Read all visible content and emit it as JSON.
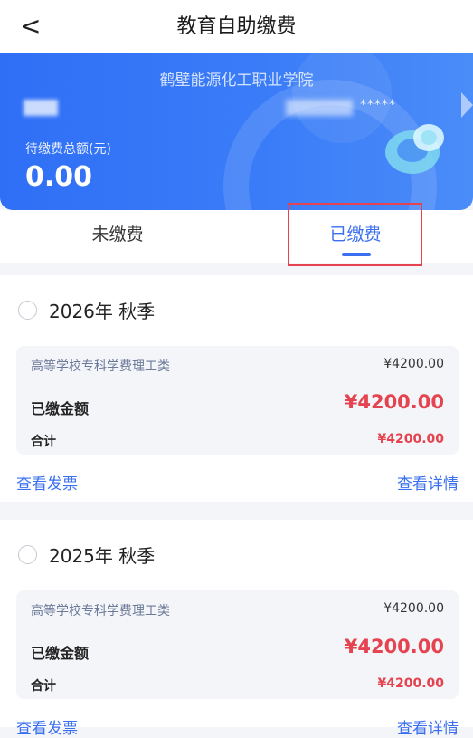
{
  "header": {
    "back_icon": "chevron-left-icon",
    "back_glyph": "<",
    "title": "教育自助缴费"
  },
  "banner": {
    "school": "鹤壁能源化工职业学院",
    "masked_id": "*****",
    "total_label": "待缴费总额(元)",
    "total_amount": "0.00",
    "accent": "#3a7cf8"
  },
  "tabs": [
    {
      "label": "未缴费",
      "active": false
    },
    {
      "label": "已缴费",
      "active": true
    }
  ],
  "records": [
    {
      "term": "2026年 秋季",
      "item": "高等学校专科学费理工类",
      "item_price": "¥4200.00",
      "paid_label": "已缴金额",
      "paid_value": "¥4200.00",
      "sum_label": "合计",
      "sum_value": "¥4200.00",
      "invoice_link": "查看发票",
      "detail_link": "查看详情"
    },
    {
      "term": "2025年 秋季",
      "item": "高等学校专科学费理工类",
      "item_price": "¥4200.00",
      "paid_label": "已缴金额",
      "paid_value": "¥4200.00",
      "sum_label": "合计",
      "sum_value": "¥4200.00",
      "invoice_link": "查看发票",
      "detail_link": "查看详情"
    }
  ],
  "colors": {
    "primary": "#3a6ff0",
    "amount": "#e4434f",
    "highlight": "#e4434f"
  }
}
